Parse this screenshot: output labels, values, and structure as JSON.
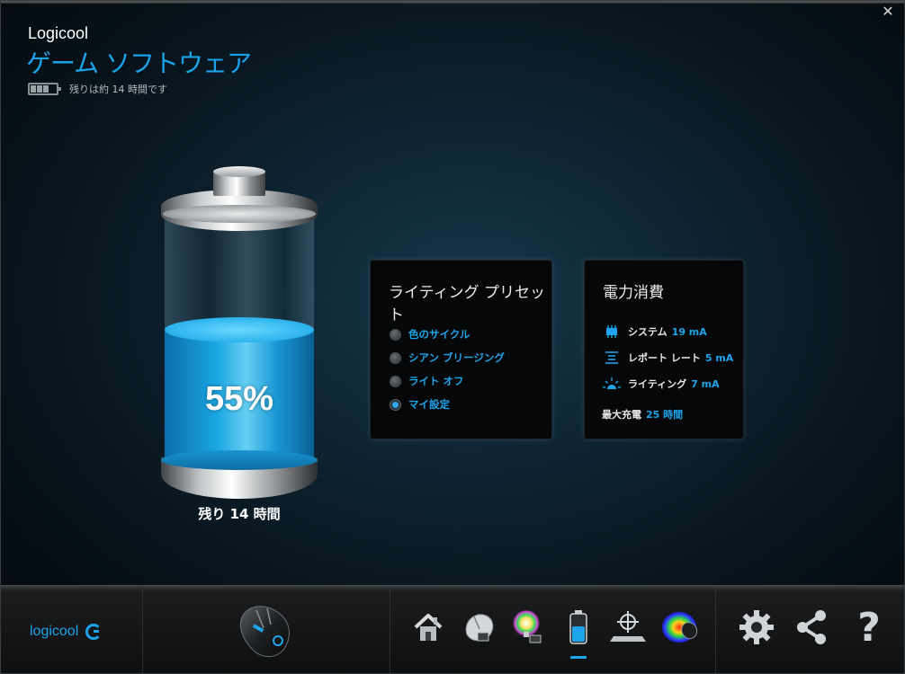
{
  "window": {
    "close_glyph": "✕"
  },
  "header": {
    "brand": "Logicool",
    "title": "ゲーム ソフトウェア",
    "battery_status": "残りは約 14 時間です"
  },
  "battery": {
    "percent_text": "55%",
    "level": 0.55,
    "remaining_text": "残り 14 時間",
    "accent_color": "#1aa6e3"
  },
  "lighting": {
    "title": "ライティング プリセット",
    "presets": [
      {
        "label": "色のサイクル",
        "selected": false
      },
      {
        "label": "シアン ブリージング",
        "selected": false
      },
      {
        "label": "ライト オフ",
        "selected": false
      },
      {
        "label": "マイ設定",
        "selected": true
      }
    ]
  },
  "power": {
    "title": "電力消費",
    "rows": [
      {
        "icon": "chip-icon",
        "label": "システム",
        "value": "19 mA"
      },
      {
        "icon": "report-rate-icon",
        "label": "レポート レート",
        "value": "5 mA"
      },
      {
        "icon": "lighting-sun-icon",
        "label": "ライティング",
        "value": "7 mA"
      }
    ],
    "max_charge_label": "最大充電",
    "max_charge_value": "25 時間"
  },
  "bottombar": {
    "logo_text": "logicool",
    "nav_icons": [
      "home-icon",
      "mouse-customize-icon",
      "lighting-icon",
      "battery-icon",
      "pointer-settings-icon",
      "heatmap-icon"
    ],
    "active_nav": "battery-icon",
    "util_icons": [
      "gear-icon",
      "share-icon",
      "help-icon"
    ],
    "help_glyph": "?"
  },
  "colors": {
    "accent": "#1ea4ea",
    "panel_bg": "#050708"
  }
}
